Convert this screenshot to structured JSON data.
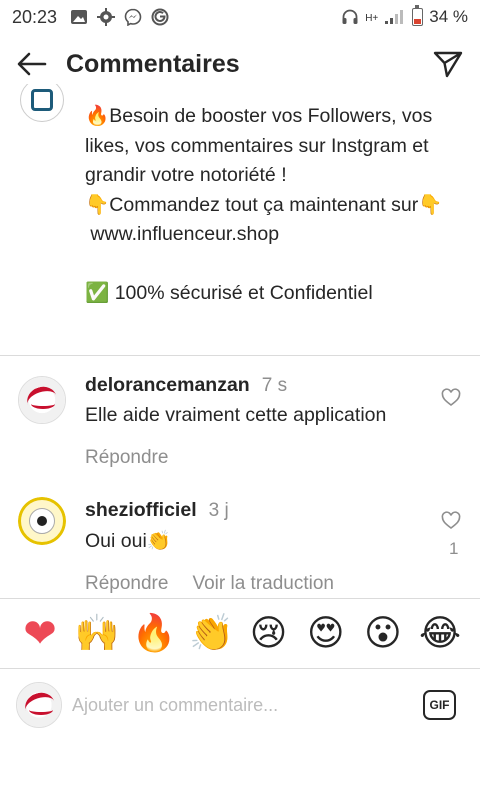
{
  "status_bar": {
    "time": "20:23",
    "left_icons": [
      "gallery-icon",
      "settings-icon",
      "messenger-icon",
      "g-icon"
    ],
    "network": "H+",
    "battery": "34 %"
  },
  "header": {
    "title": "Commentaires"
  },
  "caption": {
    "text": "🔥Besoin de booster vos Followers, vos likes, vos commentaires sur Instgram et grandir votre notoriété !\n👇Commandez tout ça maintenant sur👇\n www.influenceur.shop\n\n✅ 100% sécurisé et Confidentiel"
  },
  "comments": [
    {
      "username": "delorancemanzan",
      "time": "7 s",
      "text": "Elle aide vraiment cette application",
      "reply_label": "Répondre",
      "likes": ""
    },
    {
      "username": "sheziofficiel",
      "time": "3 j",
      "text": "Oui oui👏",
      "reply_label": "Répondre",
      "translate_label": "Voir la traduction",
      "likes": "1"
    }
  ],
  "emoji_bar": [
    "❤",
    "🙌",
    "🔥",
    "👏",
    "😢",
    "😍",
    "😮",
    "😂"
  ],
  "composer": {
    "placeholder": "Ajouter un commentaire...",
    "gif_label": "GIF"
  },
  "colors": {
    "text": "#262626",
    "muted": "#8e8e8e",
    "divider": "#dbdbdb",
    "heart": "#ed4956"
  }
}
